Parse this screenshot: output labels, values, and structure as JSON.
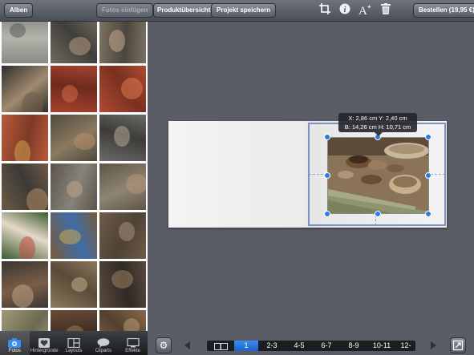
{
  "toolbar": {
    "albums_label": "Alben",
    "add_photos_label": "Fotos einfügen",
    "product_overview_label": "Produktübersicht",
    "save_project_label": "Projekt speichern",
    "order_label": "Bestellen (19,95 €)",
    "icons": [
      "crop-icon",
      "info-icon",
      "add-text-icon",
      "trash-icon"
    ]
  },
  "photos": {
    "thumbnails": [
      {
        "subject": "metal-spirals"
      },
      {
        "subject": "hands-carving"
      },
      {
        "subject": "hands-tool"
      },
      {
        "subject": "iron-cauldron"
      },
      {
        "subject": "red-wool"
      },
      {
        "subject": "red-wool-2"
      },
      {
        "subject": "dyed-wool-skeins"
      },
      {
        "subject": "person-weaving"
      },
      {
        "subject": "person-lying"
      },
      {
        "subject": "woman-spinning"
      },
      {
        "subject": "bearded-man-hood"
      },
      {
        "subject": "bearded-man"
      },
      {
        "subject": "reenactor-red-cloak"
      },
      {
        "subject": "wooden-bowl-cloth"
      },
      {
        "subject": "bowls-table"
      },
      {
        "subject": "hands-weaving"
      },
      {
        "subject": "grain-basket"
      },
      {
        "subject": "loom-tablet"
      },
      {
        "subject": "straw-bundle"
      },
      {
        "subject": "leather-work"
      },
      {
        "subject": "wood-craft"
      }
    ]
  },
  "tabs": [
    {
      "label": "Fotos",
      "icon": "camera-icon",
      "active": true
    },
    {
      "label": "Hintergründe",
      "icon": "heart-icon",
      "active": false
    },
    {
      "label": "Layouts",
      "icon": "layout-icon",
      "active": false
    },
    {
      "label": "Cliparts",
      "icon": "speech-bubble-icon",
      "active": false
    },
    {
      "label": "Effekte",
      "icon": "monitor-icon",
      "active": false
    }
  ],
  "editor": {
    "position_text": "X: 2,86 cm Y: 2,40 cm",
    "size_text": "B: 14,26 cm H: 10,71 cm"
  },
  "pages": {
    "items": [
      "1",
      "2-3",
      "4-5",
      "6-7",
      "8-9",
      "10-11",
      "12-"
    ],
    "active_index": 0
  },
  "colors": {
    "accent": "#2f7be6",
    "work_background": "#5a5d66",
    "toolbar": "#5c6169"
  }
}
